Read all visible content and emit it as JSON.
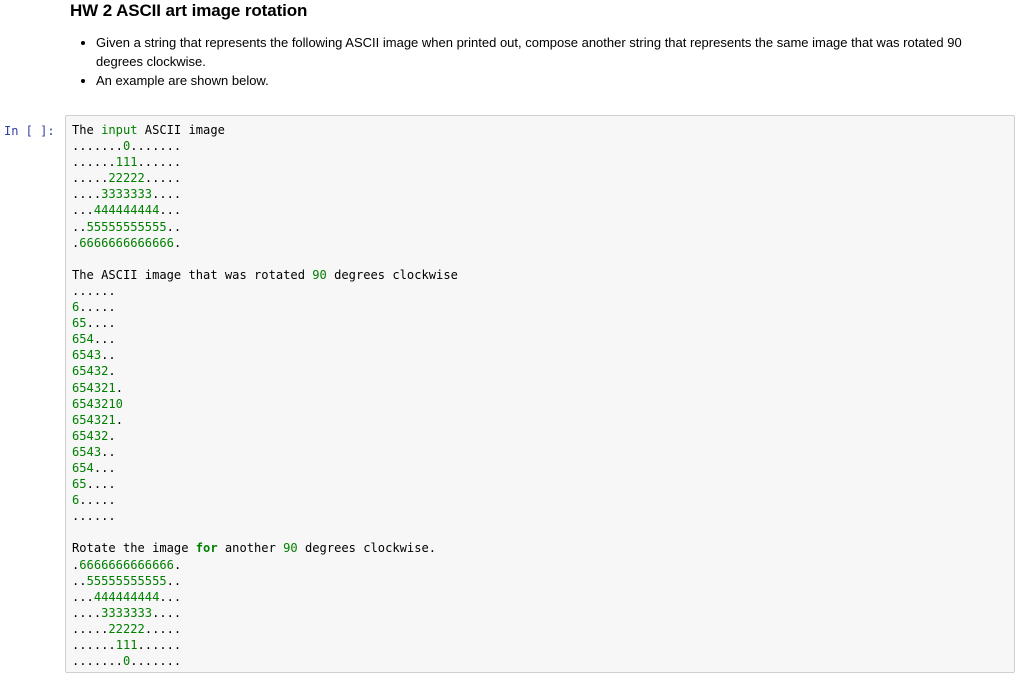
{
  "markdown": {
    "title": "HW 2 ASCII art image rotation",
    "bullets": [
      "Given a string that represents the following ASCII image when printed out, compose another string that represents the same image that was rotated 90 degrees clockwise.",
      "An example are shown below."
    ]
  },
  "code_cell": {
    "prompt": "In [ ]:",
    "lines": [
      [
        [
          "The ",
          "normal"
        ],
        [
          "input",
          "green"
        ],
        [
          " ASCII image",
          "normal"
        ]
      ],
      [
        [
          ".......",
          "normal"
        ],
        [
          "0",
          "green"
        ],
        [
          ".......",
          "normal"
        ]
      ],
      [
        [
          "......",
          "normal"
        ],
        [
          "111",
          "green"
        ],
        [
          "......",
          "normal"
        ]
      ],
      [
        [
          ".....",
          "normal"
        ],
        [
          "22222",
          "green"
        ],
        [
          ".....",
          "normal"
        ]
      ],
      [
        [
          "....",
          "normal"
        ],
        [
          "3333333",
          "green"
        ],
        [
          "....",
          "normal"
        ]
      ],
      [
        [
          "...",
          "normal"
        ],
        [
          "444444444",
          "green"
        ],
        [
          "...",
          "normal"
        ]
      ],
      [
        [
          "..",
          "normal"
        ],
        [
          "55555555555",
          "green"
        ],
        [
          "..",
          "normal"
        ]
      ],
      [
        [
          ".",
          "normal"
        ],
        [
          "6666666666666",
          "green"
        ],
        [
          ".",
          "normal"
        ]
      ],
      [],
      [
        [
          "The ASCII image that was rotated ",
          "normal"
        ],
        [
          "90",
          "green"
        ],
        [
          " degrees clockwise",
          "normal"
        ]
      ],
      [
        [
          "......",
          "normal"
        ]
      ],
      [
        [
          "6",
          "green"
        ],
        [
          ".....",
          "normal"
        ]
      ],
      [
        [
          "65",
          "green"
        ],
        [
          "....",
          "normal"
        ]
      ],
      [
        [
          "654",
          "green"
        ],
        [
          "...",
          "normal"
        ]
      ],
      [
        [
          "6543",
          "green"
        ],
        [
          "..",
          "normal"
        ]
      ],
      [
        [
          "65432",
          "green"
        ],
        [
          ".",
          "normal"
        ]
      ],
      [
        [
          "654321",
          "green"
        ],
        [
          ".",
          "normal"
        ]
      ],
      [
        [
          "6543210",
          "green"
        ]
      ],
      [
        [
          "654321",
          "green"
        ],
        [
          ".",
          "normal"
        ]
      ],
      [
        [
          "65432",
          "green"
        ],
        [
          ".",
          "normal"
        ]
      ],
      [
        [
          "6543",
          "green"
        ],
        [
          "..",
          "normal"
        ]
      ],
      [
        [
          "654",
          "green"
        ],
        [
          "...",
          "normal"
        ]
      ],
      [
        [
          "65",
          "green"
        ],
        [
          "....",
          "normal"
        ]
      ],
      [
        [
          "6",
          "green"
        ],
        [
          ".....",
          "normal"
        ]
      ],
      [
        [
          "......",
          "normal"
        ]
      ],
      [],
      [
        [
          "Rotate the image ",
          "normal"
        ],
        [
          "for",
          "kw"
        ],
        [
          " another ",
          "normal"
        ],
        [
          "90",
          "green"
        ],
        [
          " degrees clockwise.",
          "normal"
        ]
      ],
      [
        [
          ".",
          "normal"
        ],
        [
          "6666666666666",
          "green"
        ],
        [
          ".",
          "normal"
        ]
      ],
      [
        [
          "..",
          "normal"
        ],
        [
          "55555555555",
          "green"
        ],
        [
          "..",
          "normal"
        ]
      ],
      [
        [
          "...",
          "normal"
        ],
        [
          "444444444",
          "green"
        ],
        [
          "...",
          "normal"
        ]
      ],
      [
        [
          "....",
          "normal"
        ],
        [
          "3333333",
          "green"
        ],
        [
          "....",
          "normal"
        ]
      ],
      [
        [
          ".....",
          "normal"
        ],
        [
          "22222",
          "green"
        ],
        [
          ".....",
          "normal"
        ]
      ],
      [
        [
          "......",
          "normal"
        ],
        [
          "111",
          "green"
        ],
        [
          "......",
          "normal"
        ]
      ],
      [
        [
          ".......",
          "normal"
        ],
        [
          "0",
          "green"
        ],
        [
          ".......",
          "normal"
        ]
      ]
    ]
  },
  "colors": {
    "prompt": "#303f9f",
    "number_literal": "#008000",
    "keyword": "#008000",
    "cell_background": "#f7f7f7",
    "cell_border": "#cfcfcf"
  }
}
